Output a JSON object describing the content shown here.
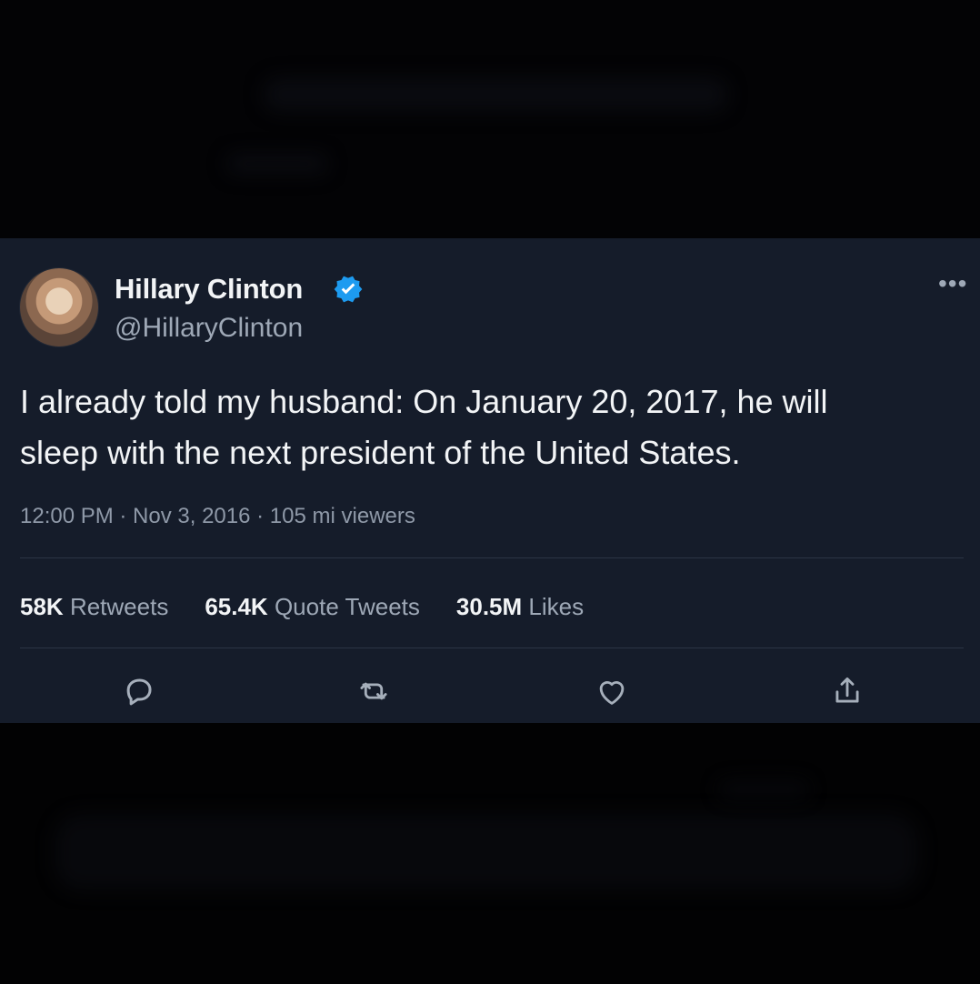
{
  "tweet": {
    "name": "Hillary Clinton",
    "handle": "@HillaryClinton",
    "text_line1": "I already told my husband: On January 20, 2017, he will",
    "text_line2": "sleep with the next president of the United States.",
    "meta": "12:00 PM · Nov 3, 2016 · 105 mi viewers"
  },
  "stats": {
    "retweets_value": "58K",
    "retweets_label": "Retweets",
    "quotes_value": "65.4K",
    "quotes_label": "Quote Tweets",
    "likes_value": "30.5M",
    "likes_label": "Likes"
  },
  "icons": {
    "verified": "verified-badge",
    "more": "more-icon",
    "reply": "reply-icon",
    "retweet": "retweet-icon",
    "like": "heart-icon",
    "share": "share-icon"
  },
  "colors": {
    "background": "#151c2a",
    "text_primary": "#f2f4f6",
    "text_secondary": "#9ea8b6",
    "verified": "#1d9bf0"
  }
}
